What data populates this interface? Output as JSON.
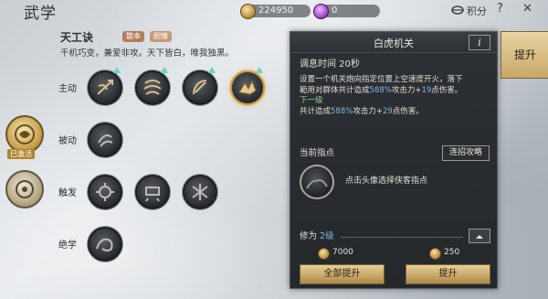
{
  "header": {
    "title": "武学",
    "currency_gold": "224950",
    "currency_gem": "0",
    "points_label": "积分",
    "help_label": "?",
    "close_label": "✕"
  },
  "skill_group": {
    "name": "天工诀",
    "tags": [
      "散本",
      "剧情"
    ],
    "description": "千机巧变，兼爱非攻。天下皆白，唯我独黑。"
  },
  "rows": [
    {
      "label": "主动"
    },
    {
      "label": "被动"
    },
    {
      "label": "触发"
    },
    {
      "label": "绝学"
    }
  ],
  "left_badge": {
    "label": "已激活"
  },
  "detail": {
    "title": "白虎机关",
    "info_label": "i",
    "cooldown": "调息时间 20秒",
    "desc_line1": "设置一个机关炮向指定位置上空速度开火，落下",
    "desc_line2a": "範用对群体共计造成",
    "desc_line2_pct": "588%",
    "desc_line2b": "攻击力+",
    "desc_line2_flat": "19",
    "desc_line2c": "点伤害。",
    "next_level_label": "下一级",
    "next_line_a": "共计造成",
    "next_line_pct": "588%",
    "next_line_b": "攻击力+",
    "next_line_flat": "29",
    "next_line_c": "点伤害。",
    "guidance_label": "当前指点",
    "combo_button": "连招攻略",
    "portrait_hint": "点击头像选择侠客指点",
    "level_label": "修为",
    "level_value": "2级",
    "cost_all": "7000",
    "cost_one": "250",
    "upgrade_all_button": "全部提升",
    "upgrade_button": "提升"
  },
  "side_tab": {
    "label": "提升"
  },
  "colors": {
    "accent_gold": "#c7a765",
    "highlight_blue": "#7fb7e0",
    "highlight_green": "#8fd08a",
    "upgrade_arrow": "#6cd2c8"
  }
}
